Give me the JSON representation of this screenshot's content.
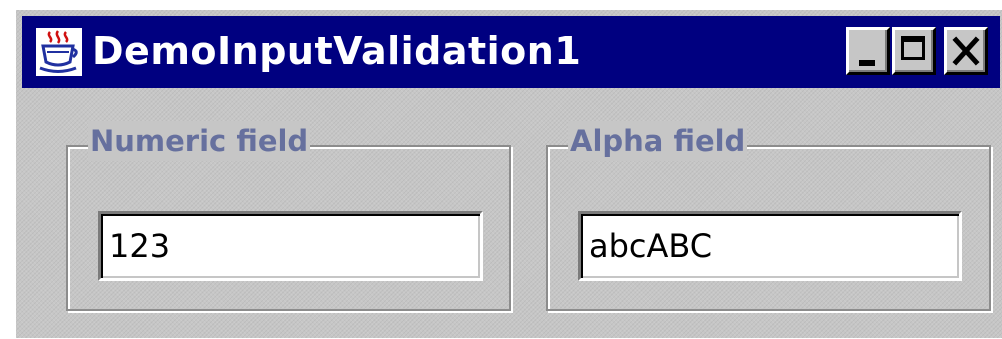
{
  "window": {
    "title": "DemoInputValidation1",
    "icon": "java-coffee-cup-icon",
    "controls": {
      "minimize": "minimize-icon",
      "maximize": "maximize-icon",
      "close": "close-icon"
    }
  },
  "numeric_group": {
    "title": "Numeric field",
    "field_value": "123"
  },
  "alpha_group": {
    "title": "Alpha field",
    "field_value": "abcABC"
  },
  "colors": {
    "titlebar": "#000080",
    "title_text": "#ffffff",
    "panel": "#c6c6c6",
    "group_title": "#66709e",
    "field_bg": "#ffffff"
  }
}
